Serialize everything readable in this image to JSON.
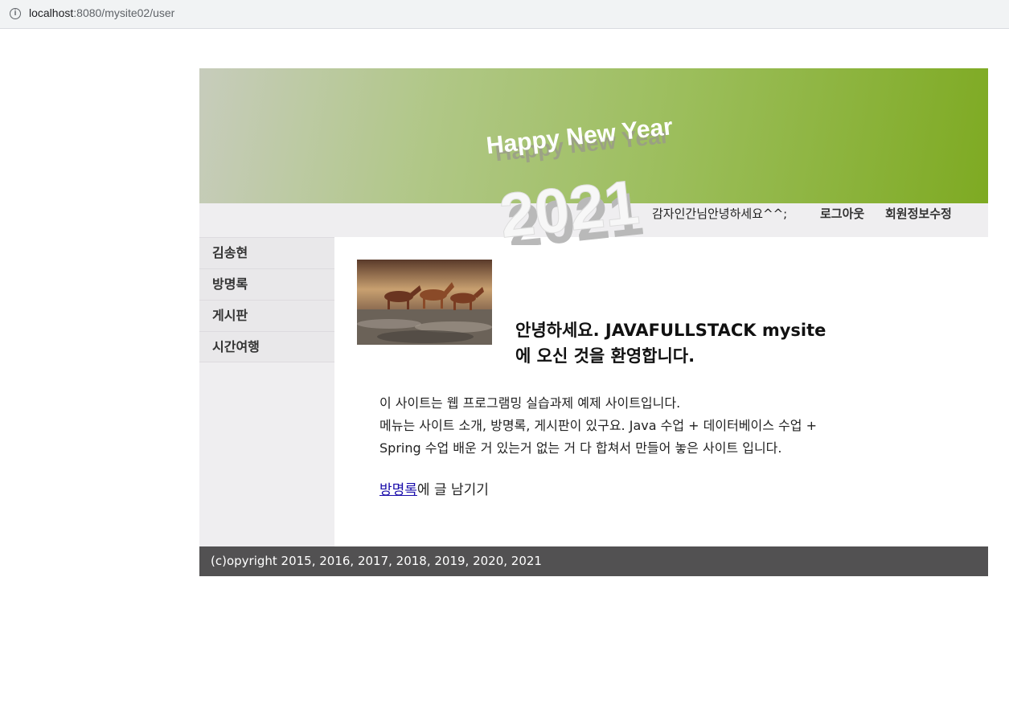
{
  "browser": {
    "url_host": "localhost",
    "url_path": ":8080/mysite02/user"
  },
  "header": {
    "banner_line1": "Happy New Year",
    "banner_line2": "2021",
    "greeting": "감자인간님안녕하세요^^;",
    "logout_label": "로그아웃",
    "edit_profile_label": "회원정보수정"
  },
  "sidebar": {
    "items": [
      {
        "label": "김송현"
      },
      {
        "label": "방명록"
      },
      {
        "label": "게시판"
      },
      {
        "label": "시간여행"
      }
    ]
  },
  "main": {
    "welcome_line1": "안녕하세요. JAVAFULLSTACK mysite",
    "welcome_line2": "에 오신 것을 환영합니다.",
    "desc_line1": "이 사이트는 웹 프로그램밍 실습과제 예제 사이트입니다.",
    "desc_line2": "메뉴는 사이트 소개, 방명록, 게시판이 있구요. Java 수업 + 데이터베이스 수업 +",
    "desc_line3": "Spring 수업 배운 거 있는거 없는 거 다 합쳐서 만들어 놓은 사이트 입니다.",
    "guestbook_link": "방명록",
    "guestbook_suffix": "에 글 남기기"
  },
  "footer": {
    "copyright": "(c)opyright 2015, 2016, 2017, 2018, 2019, 2020, 2021"
  },
  "colors": {
    "footer_bg": "#525152",
    "link": "#1a0dab",
    "banner_accent": "#7eaa22"
  }
}
